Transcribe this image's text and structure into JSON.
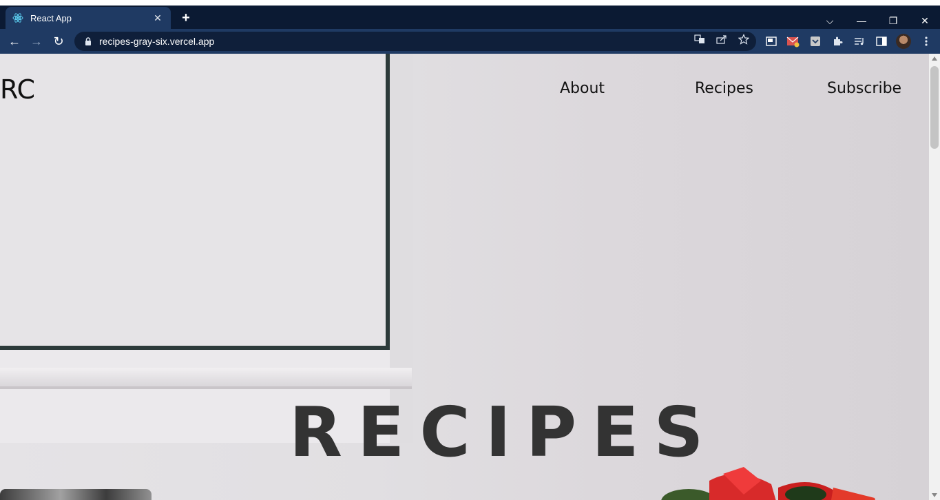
{
  "browser": {
    "tab_title": "React App",
    "tab_close": "✕",
    "new_tab": "+",
    "url": "recipes-gray-six.vercel.app",
    "controls": {
      "dropdown": "⌵",
      "minimize": "—",
      "restore": "❐",
      "close": "✕"
    },
    "nav": {
      "back": "←",
      "forward": "→",
      "reload": "↻"
    }
  },
  "site": {
    "brand": "RC",
    "nav_links": [
      "About",
      "Recipes",
      "Subscribe"
    ],
    "hero_title": "RECIPES"
  },
  "colors": {
    "tabbar": "#0b1a33",
    "toolbar": "#1f3a63",
    "hero_text": "#333333"
  },
  "icons": [
    "react-icon",
    "lock-icon",
    "translate-icon",
    "share-icon",
    "star-icon",
    "pip-icon",
    "mail-icon",
    "pocket-icon",
    "extensions-icon",
    "reading-list-icon",
    "side-panel-icon",
    "more-icon"
  ]
}
